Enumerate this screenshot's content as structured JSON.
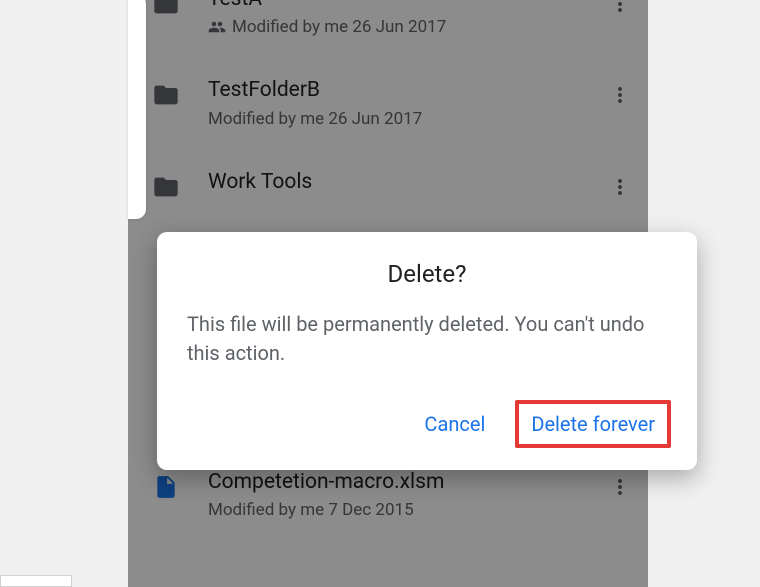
{
  "files": [
    {
      "name": "TestA",
      "subtitle": "Modified by me 26 Jun 2017",
      "shared": true,
      "icon": "folder"
    },
    {
      "name": "TestFolderB",
      "subtitle": "Modified by me 26 Jun 2017",
      "shared": false,
      "icon": "folder"
    },
    {
      "name": "Work Tools",
      "subtitle": "",
      "shared": false,
      "icon": "folder"
    },
    {
      "name": "Competetion-macro.xlsm",
      "subtitle": "Modified by me 7 Dec 2015",
      "shared": false,
      "icon": "file"
    }
  ],
  "dialog": {
    "title": "Delete?",
    "body": "This file will be permanently deleted. You can't undo this action.",
    "cancel": "Cancel",
    "confirm": "Delete forever"
  },
  "filler": {
    "empty": ""
  }
}
